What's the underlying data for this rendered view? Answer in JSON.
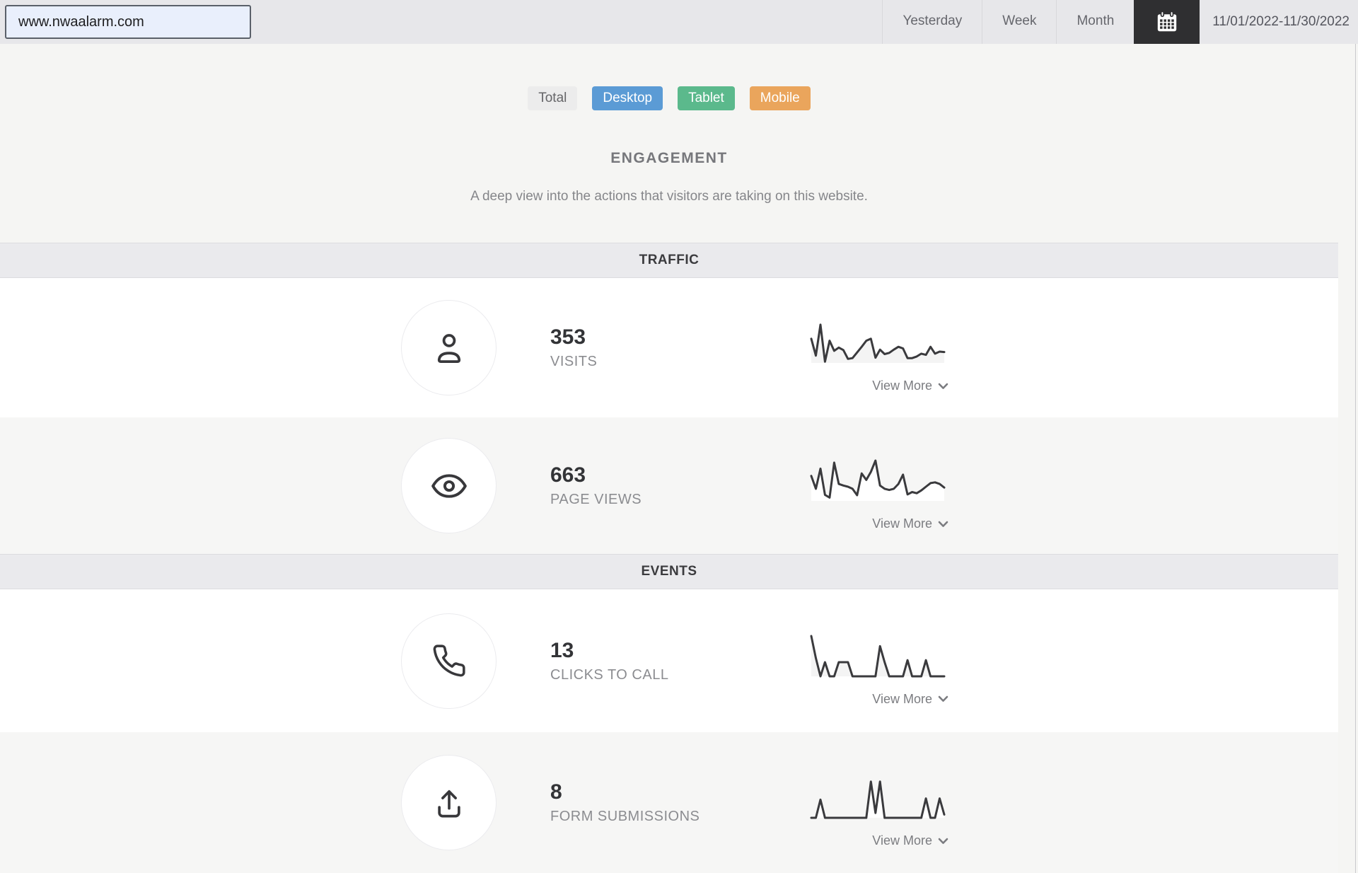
{
  "topbar": {
    "url_value": "www.nwaalarm.com",
    "range_tabs": [
      {
        "label": "Yesterday"
      },
      {
        "label": "Week"
      },
      {
        "label": "Month"
      }
    ],
    "calendar_icon": "calendar-icon",
    "calendar_button_bg": "#2f2f31",
    "date_range": "11/01/2022-11/30/2022"
  },
  "filters": {
    "buttons": [
      {
        "label": "Total",
        "bg": "#ececec",
        "fg": "#666669"
      },
      {
        "label": "Desktop",
        "bg": "#5b9bd5",
        "fg": "#ffffff"
      },
      {
        "label": "Tablet",
        "bg": "#5bb98c",
        "fg": "#ffffff"
      },
      {
        "label": "Mobile",
        "bg": "#eaa55c",
        "fg": "#ffffff"
      }
    ]
  },
  "engagement": {
    "title": "ENGAGEMENT",
    "subtitle": "A deep view into the actions that visitors are taking on this website."
  },
  "sections": [
    {
      "header": "TRAFFIC",
      "rows": [
        {
          "icon": "user-icon",
          "value": "353",
          "label": "VISITS",
          "view_more": "View More",
          "view_more_icon": "chevron-down-icon",
          "spark": [
            60,
            18,
            95,
            3,
            55,
            30,
            38,
            32,
            10,
            12,
            26,
            40,
            55,
            60,
            13,
            33,
            22,
            25,
            33,
            40,
            36,
            12,
            12,
            16,
            23,
            20,
            40,
            23,
            28,
            27
          ]
        },
        {
          "icon": "eye-icon",
          "value": "663",
          "label": "PAGE VIEWS",
          "view_more": "View More",
          "view_more_icon": "chevron-down-icon",
          "spark": [
            62,
            30,
            80,
            15,
            8,
            95,
            42,
            38,
            35,
            30,
            14,
            68,
            52,
            72,
            100,
            38,
            30,
            27,
            30,
            42,
            65,
            16,
            22,
            19,
            26,
            35,
            44,
            46,
            42,
            33
          ]
        }
      ]
    },
    {
      "header": "EVENTS",
      "rows": [
        {
          "icon": "phone-icon",
          "value": "13",
          "label": "CLICKS TO CALL",
          "view_more": "View More",
          "view_more_icon": "chevron-down-icon",
          "spark": [
            100,
            45,
            0,
            35,
            0,
            0,
            35,
            35,
            35,
            0,
            0,
            0,
            0,
            0,
            0,
            75,
            35,
            0,
            0,
            0,
            0,
            40,
            0,
            0,
            0,
            40,
            0,
            0,
            0,
            0
          ]
        },
        {
          "icon": "upload-icon",
          "value": "8",
          "label": "FORM SUBMISSIONS",
          "view_more": "View More",
          "view_more_icon": "chevron-down-icon",
          "spark": [
            0,
            0,
            45,
            0,
            0,
            0,
            0,
            0,
            0,
            0,
            0,
            0,
            0,
            90,
            12,
            90,
            0,
            0,
            0,
            0,
            0,
            0,
            0,
            0,
            0,
            48,
            0,
            0,
            48,
            8
          ]
        }
      ]
    }
  ],
  "colors": {
    "spark_line": "#3a3a3d",
    "topbar_bg": "#e7e7ea",
    "band_bg": "#eaeaed",
    "input_bg": "#e9effc"
  }
}
